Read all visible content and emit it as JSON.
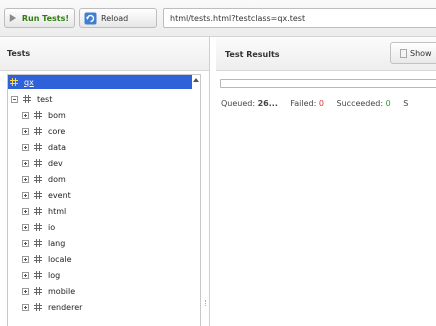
{
  "toolbar": {
    "run_label": "Run Tests!",
    "reload_label": "Reload",
    "url_value": "html/tests.html?testclass=qx.test"
  },
  "tests_pane": {
    "title": "Tests",
    "root": "qx",
    "test_node": "test",
    "items": [
      "bom",
      "core",
      "data",
      "dev",
      "dom",
      "event",
      "html",
      "io",
      "lang",
      "locale",
      "log",
      "mobile",
      "renderer"
    ]
  },
  "results_pane": {
    "title": "Test Results",
    "show_label": "Show",
    "progress_fraction": 0,
    "status": {
      "queued_label": "Queued:",
      "queued_value": "26...",
      "failed_label": "Failed:",
      "failed_value": "0",
      "succeeded_label": "Succeeded:",
      "succeeded_value": "0",
      "skipped_label": "S"
    }
  },
  "colors": {
    "selection": "#2f62d8",
    "run_text": "#2f7d12",
    "failed": "#dd3333",
    "succeeded": "#2a9b2a"
  }
}
